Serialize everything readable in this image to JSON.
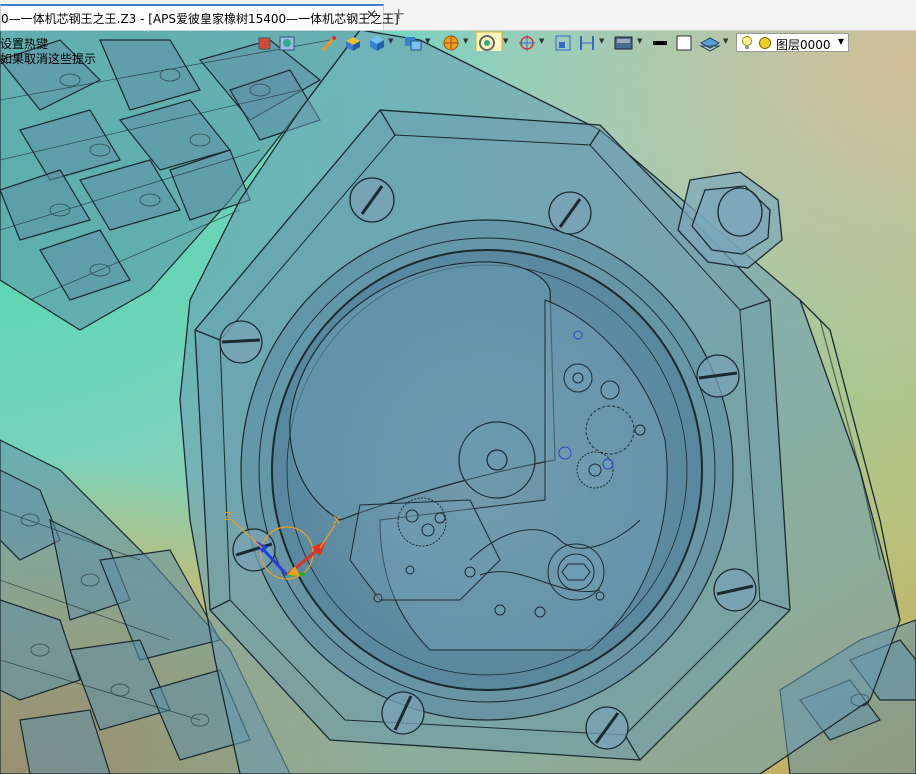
{
  "tab": {
    "title": "0—一体机芯钢王之王.Z3 - [APS爱彼皇家橡树15400—一体机芯钢王之王]",
    "close": "✕",
    "add": "+"
  },
  "hints": {
    "line1": "设置热键",
    "line2": "如果取消这些提示"
  },
  "toolbar": {
    "layer_name": "图层0000",
    "icons": [
      "snap-icon",
      "grid-icon",
      "edit-icon",
      "box-icon",
      "cube-icon",
      "view-icon",
      "render-icon",
      "target-icon",
      "layout-icon",
      "dimension-icon",
      "display-icon",
      "color-icon",
      "frame-icon",
      "layer-stack-icon",
      "bulb-icon",
      "layer-color-icon"
    ]
  },
  "gizmo": {
    "x_label": "X",
    "z_label": "Z"
  },
  "colors": {
    "tab_accent": "#3f7fd0",
    "wire": "#1a2a30",
    "glass": "#5c8ea8",
    "axis_x": "#e03020",
    "axis_y": "#20b030",
    "axis_z": "#2040e0",
    "gizmo_orange": "#f0a020"
  }
}
